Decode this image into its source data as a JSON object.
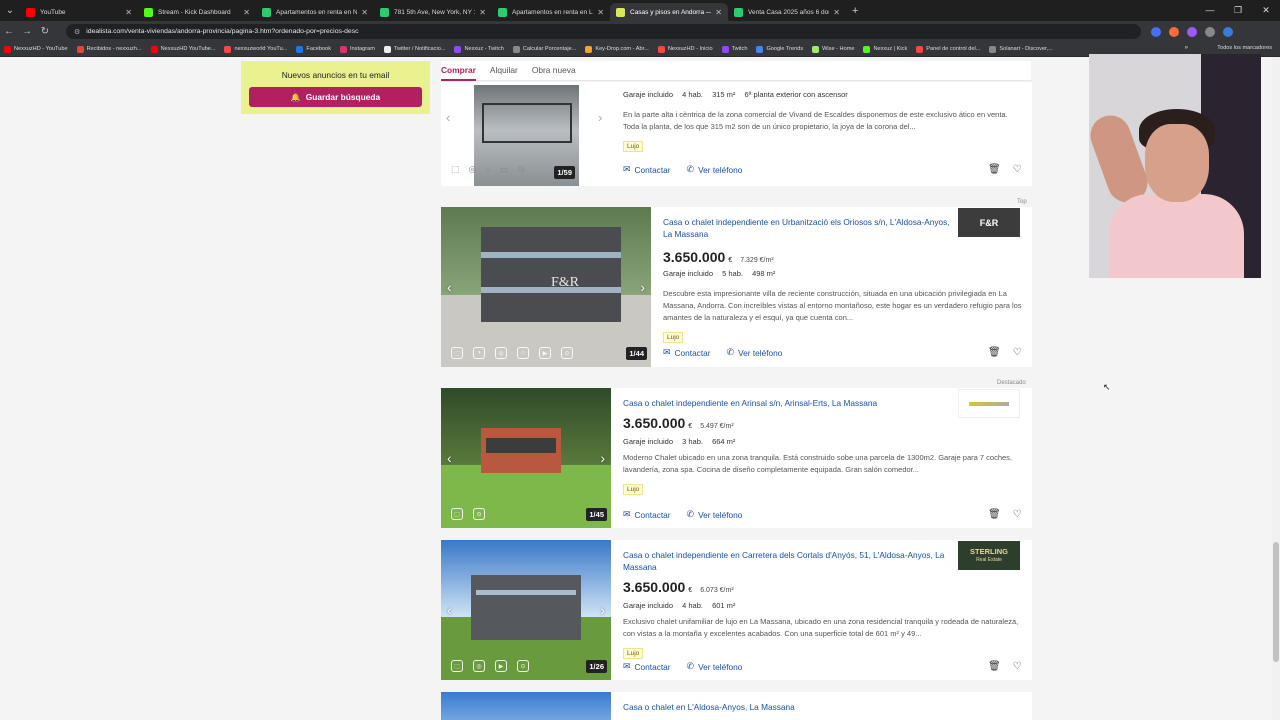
{
  "browser": {
    "tabs": [
      {
        "label": "YouTube",
        "color": "#ff0000",
        "active": false
      },
      {
        "label": "Stream - Kick Dashboard",
        "color": "#53fc18",
        "active": false
      },
      {
        "label": "Apartamentos en renta en New",
        "color": "#2ecc71",
        "active": false
      },
      {
        "label": "781 5th Ave, New York, NY 100",
        "color": "#2ecc71",
        "active": false
      },
      {
        "label": "Apartamentos en renta en Las",
        "color": "#2ecc71",
        "active": false
      },
      {
        "label": "Casas y pisos en Andorra — ide",
        "color": "#d7e85a",
        "active": true
      },
      {
        "label": "Venta Casa 2025 años 6 dormi",
        "color": "#2ecc71",
        "active": false
      }
    ],
    "new_tab": "+",
    "url": "idealista.com/venta-viviendas/andorra-provincia/pagina-3.htm?ordenado-por=precios-desc",
    "bookmarks": [
      {
        "label": "NexxuzHD - YouTube",
        "color": "#ff0000"
      },
      {
        "label": "Recibidos - nexxuzh...",
        "color": "#ea4335"
      },
      {
        "label": "NexxuzHD YouTube...",
        "color": "#ff0000"
      },
      {
        "label": "nexxuzworld YouTu...",
        "color": "#ff4444"
      },
      {
        "label": "Facebook",
        "color": "#1877f2"
      },
      {
        "label": "Instagram",
        "color": "#e1306c"
      },
      {
        "label": "Twitter / Notificacio...",
        "color": "#eeeeee"
      },
      {
        "label": "Nexxuz - Twitch",
        "color": "#9146ff"
      },
      {
        "label": "Calcular Porcentaje...",
        "color": "#888888"
      },
      {
        "label": "Key-Drop.com - Abr...",
        "color": "#f5a623"
      },
      {
        "label": "NexxuzHD - Inicio",
        "color": "#ff4444"
      },
      {
        "label": "Twitch",
        "color": "#9146ff"
      },
      {
        "label": "Google Trends",
        "color": "#4285f4"
      },
      {
        "label": "Wise - Home",
        "color": "#9fe870"
      },
      {
        "label": "Nexxuz | Kick",
        "color": "#53fc18"
      },
      {
        "label": "Panel de control del...",
        "color": "#ff4444"
      },
      {
        "label": "Solanart - Discover,...",
        "color": "#888888"
      }
    ],
    "bookmarks_more": "»",
    "all_bookmarks": "Todos los marcadores"
  },
  "sidebar": {
    "alert_title": "Nuevos anuncios en tu email",
    "save_search": "Guardar búsqueda"
  },
  "filters": {
    "tabs": [
      "Comprar",
      "Alquilar",
      "Obra nueva"
    ],
    "active": "Comprar"
  },
  "listings": [
    {
      "title": "",
      "price": "",
      "features": [
        "Garaje incluido",
        "4 hab.",
        "315 m²",
        "6ª planta exterior con ascensor"
      ],
      "description": "En la parte alta i cèntrica de la zona comercial de Vivand de Escaldes disponemos de este exclusivo ático en venta. Toda la planta, de los que 315 m2 son de un único propietario, la joya de la corona del...",
      "tag": "Lujo",
      "photo_count": "1/59",
      "contact": "Contactar",
      "phone": "Ver teléfono"
    },
    {
      "title": "Casa o chalet independiente en Urbanització els Oriosos s/n, L'Aldosa-Anyos, La Massana",
      "price": "3.650.000",
      "currency": "€",
      "price_per_m2": "7.329 €/m²",
      "features": [
        "Garaje incluido",
        "5 hab.",
        "498 m²"
      ],
      "description": "Descubre esta impresionante villa de reciente construcción, situada en una ubicación privilegiada en La Massana, Andorra. Con increíbles vistas al entorno montañoso, este hogar es un verdadero refugio para los amantes de la naturaleza y el esquí, ya que cuenta con...",
      "tag": "Lujo",
      "photo_count": "1/44",
      "badge": "Top",
      "agency": "F&R",
      "contact": "Contactar",
      "phone": "Ver teléfono"
    },
    {
      "title": "Casa o chalet independiente en Arinsal s/n, Arinsal-Erts, La Massana",
      "price": "3.650.000",
      "currency": "€",
      "price_per_m2": "5.497 €/m²",
      "features": [
        "Garaje incluido",
        "3 hab.",
        "664 m²"
      ],
      "description": "Moderno Chalet ubicado en una zona tranquila. Está construido sobe una parcela de 1300m2. Garaje para 7 coches, lavandería, zona spa. Cocina de diseño completamente equipada. Gran salón comedor...",
      "tag": "Lujo",
      "photo_count": "1/45",
      "badge": "Destacado",
      "agency": "",
      "contact": "Contactar",
      "phone": "Ver teléfono"
    },
    {
      "title": "Casa o chalet independiente en Carretera dels Cortals d'Anyós, 51, L'Aldosa-Anyos, La Massana",
      "price": "3.650.000",
      "currency": "€",
      "price_per_m2": "6.073 €/m²",
      "features": [
        "Garaje incluido",
        "4 hab.",
        "601 m²"
      ],
      "description": "Exclusivo chalet unifamiliar de lujo en La Massana, ubicado en una zona residencial tranquila y rodeada de naturaleza, con vistas a la montaña y excelentes acabados. Con una superficie total de 601 m² y 49...",
      "tag": "Lujo",
      "photo_count": "1/26",
      "agency": "STERLING",
      "agency_sub": "Real Estate",
      "contact": "Contactar",
      "phone": "Ver teléfono"
    },
    {
      "title": "Casa o chalet en L'Aldosa-Anyos, La Massana"
    }
  ],
  "colors": {
    "brand": "#b1215f",
    "link": "#1a4fa3",
    "alert_bg": "#e9f28f"
  }
}
